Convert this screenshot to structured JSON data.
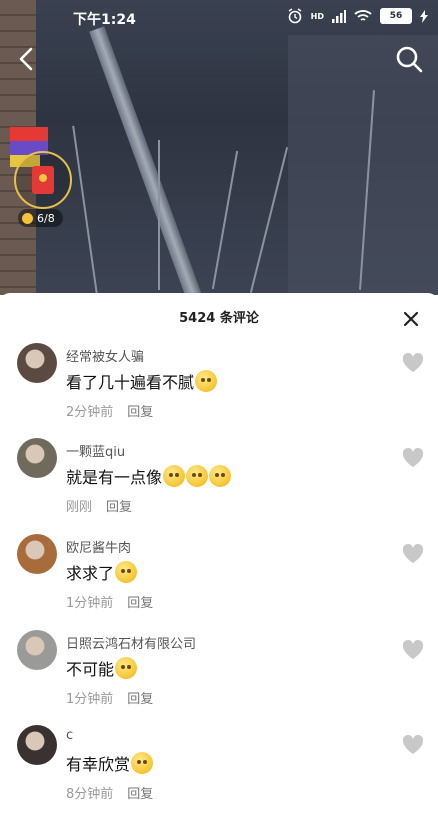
{
  "status_bar": {
    "time": "下午1:24",
    "signal": "HD",
    "battery": "56"
  },
  "video": {
    "coin_count": "6/8"
  },
  "comments_sheet": {
    "title": "5424 条评论",
    "comments": [
      {
        "username": "经常被女人骗",
        "text": "看了几十遍看不腻",
        "emoji_count": 1,
        "time": "2分钟前",
        "reply": "回复",
        "avatar_color": "#5a4a42"
      },
      {
        "username": "一颗蓝qiu",
        "text": "就是有一点像",
        "emoji_count": 3,
        "time": "刚刚",
        "reply": "回复",
        "avatar_color": "#6f6a5c"
      },
      {
        "username": "欧尼酱牛肉",
        "text": "求求了",
        "emoji_count": 1,
        "time": "1分钟前",
        "reply": "回复",
        "avatar_color": "#a86c3c"
      },
      {
        "username": "日照云鸿石材有限公司",
        "text": "不可能",
        "emoji_count": 1,
        "time": "1分钟前",
        "reply": "回复",
        "avatar_color": "#9a9a98"
      },
      {
        "username": "c",
        "text": "有幸欣赏",
        "emoji_count": 1,
        "time": "8分钟前",
        "reply": "回复",
        "avatar_color": "#3a3230"
      }
    ]
  }
}
